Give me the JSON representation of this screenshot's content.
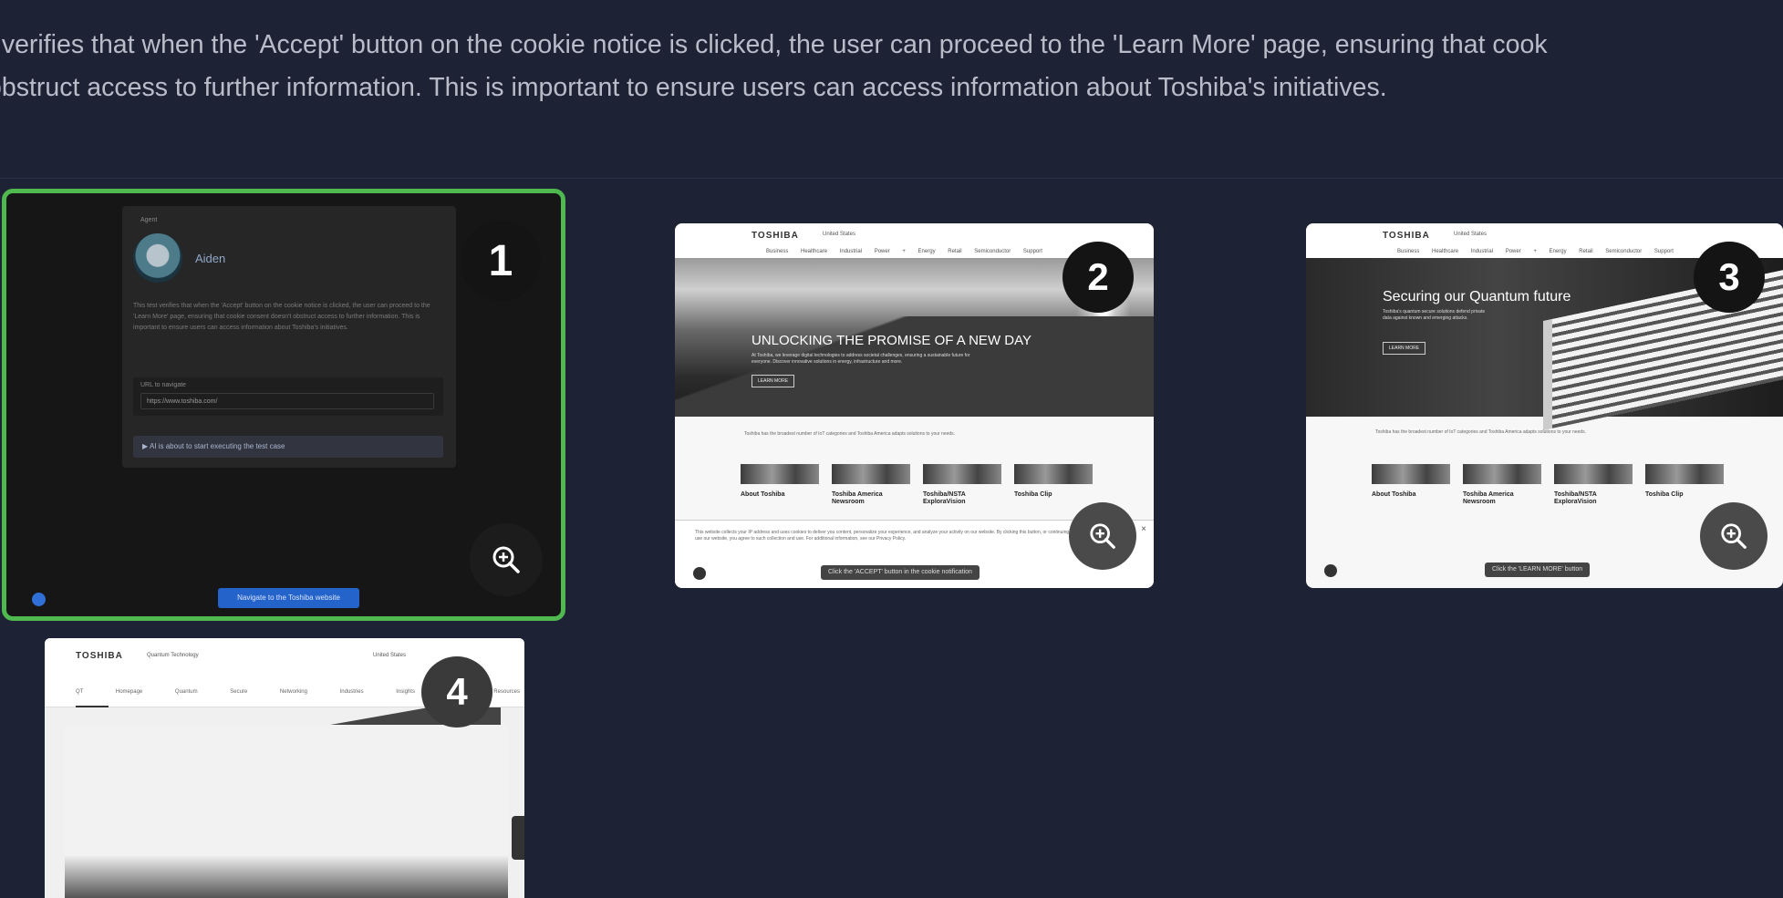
{
  "description": {
    "line1": "t verifies that when the 'Accept' button on the cookie notice is clicked, the user can proceed to the 'Learn More' page, ensuring that cook",
    "line2": "obstruct access to further information. This is important to ensure users can access information about Toshiba's initiatives."
  },
  "tiles": [
    {
      "number": "1",
      "tiny_label": "Agent",
      "agent_name": "Aiden",
      "body_text": "This test verifies that when the 'Accept' button on the cookie notice is clicked, the user can proceed to the 'Learn More' page, ensuring that cookie consent doesn't obstruct access to further information. This is important to ensure users can access information about Toshiba's initiatives.",
      "url_label": "URL to navigate",
      "url_value": "https://www.toshiba.com/",
      "running_status": "AI is about to start executing the test case",
      "action_button": "Navigate to the Toshiba website"
    },
    {
      "number": "2",
      "logo": "TOSHIBA",
      "location": "United States",
      "nav": "Business Healthcare Industrial Power + Energy Retail Semiconductor Support",
      "hero_title": "UNLOCKING THE PROMISE OF A NEW DAY",
      "hero_sub": "At Toshiba, we leverage digital technologies to address societal challenges, ensuring a sustainable future for everyone. Discover innovative solutions in energy, infrastructure and more.",
      "hero_button": "LEARN MORE",
      "notice": "Toshiba has the broadest number of IoT categories and Toshiba America adapts solutions to your needs.",
      "cards": [
        "About Toshiba",
        "Toshiba America Newsroom",
        "Toshiba/NSTA ExploraVision",
        "Toshiba Clip"
      ],
      "cookie_text": "This website collects your IP address and uses cookies to deliver you content, personalize your experience, and analyze your activity on our website. By clicking this button, or continuing to use our website, you agree to such collection and use. For additional information, see our Privacy Policy.",
      "caption": "Click the 'ACCEPT' button in the cookie notification"
    },
    {
      "number": "3",
      "logo": "TOSHIBA",
      "location": "United States",
      "nav": "Business Healthcare Industrial Power + Energy Retail Semiconductor Support",
      "hero_title": "Securing our Quantum future",
      "hero_sub": "Toshiba's quantum secure solutions defend private data against known and emerging attacks.",
      "hero_button": "LEARN MORE",
      "notice": "Toshiba has the broadest number of IoT categories and Toshiba America adapts solutions to your needs.",
      "cards": [
        "About Toshiba",
        "Toshiba America Newsroom",
        "Toshiba/NSTA ExploraVision",
        "Toshiba Clip"
      ],
      "caption": "Click the 'LEARN MORE' button"
    },
    {
      "number": "4",
      "logo": "TOSHIBA",
      "section": "Quantum Technology",
      "location": "United States",
      "tabs": "QT Homepage Quantum Secure Networking Industries Insights News Resources"
    }
  ],
  "icons": {
    "zoom": "zoom-in-icon",
    "info": "info-icon"
  }
}
